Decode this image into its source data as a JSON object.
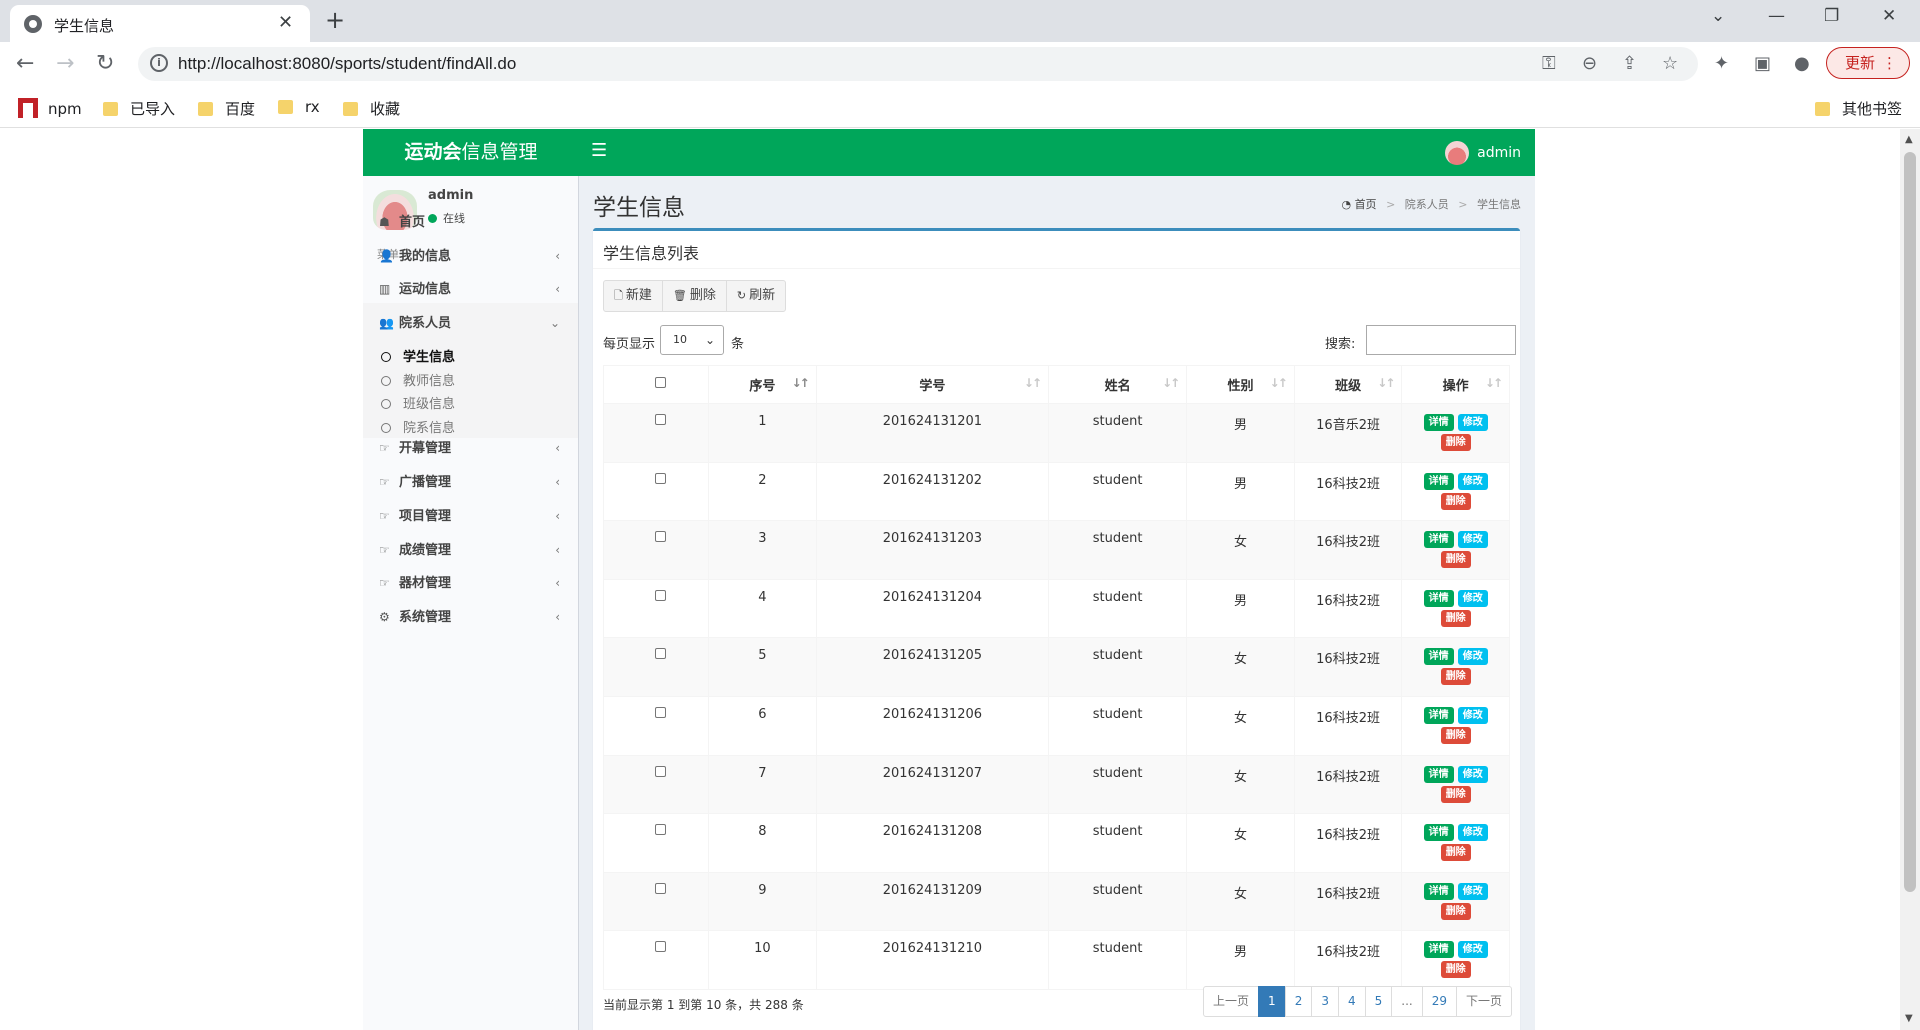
{
  "browser": {
    "tab_title": "学生信息",
    "url": "http://localhost:8080/sports/student/findAll.do",
    "update_label": "更新",
    "bookmarks": [
      {
        "label": "npm",
        "kind": "npm"
      },
      {
        "label": "已导入",
        "kind": "folder"
      },
      {
        "label": "百度",
        "kind": "folder"
      },
      {
        "label": "rx",
        "kind": "folder"
      },
      {
        "label": "收藏",
        "kind": "folder"
      }
    ],
    "other_bookmarks": "其他书签"
  },
  "app": {
    "brand_bold": "运动会",
    "brand_rest": "信息管理",
    "top_user": "admin",
    "accent": "#00a65a"
  },
  "sidebar": {
    "user_name": "admin",
    "user_status": "在线",
    "menu_header": "菜单",
    "items": [
      {
        "label": "首页",
        "icon": "home-icon",
        "glyph": "☗",
        "chevron": ""
      },
      {
        "label": "我的信息",
        "icon": "user-icon",
        "glyph": "👤",
        "chevron": "‹"
      },
      {
        "label": "运动信息",
        "icon": "bar-chart-icon",
        "glyph": "▥",
        "chevron": "‹"
      },
      {
        "label": "院系人员",
        "icon": "users-icon",
        "glyph": "👥",
        "chevron": "⌄"
      },
      {
        "label": "开幕管理",
        "icon": "hand-point-icon",
        "glyph": "☞",
        "chevron": "‹"
      },
      {
        "label": "广播管理",
        "icon": "hand-point-icon",
        "glyph": "☞",
        "chevron": "‹"
      },
      {
        "label": "项目管理",
        "icon": "hand-point-icon",
        "glyph": "☞",
        "chevron": "‹"
      },
      {
        "label": "成绩管理",
        "icon": "hand-point-icon",
        "glyph": "☞",
        "chevron": "‹"
      },
      {
        "label": "器材管理",
        "icon": "hand-point-icon",
        "glyph": "☞",
        "chevron": "‹"
      },
      {
        "label": "系统管理",
        "icon": "gear-icon",
        "glyph": "⚙",
        "chevron": "‹"
      }
    ],
    "submenu": [
      "学生信息",
      "教师信息",
      "班级信息",
      "院系信息"
    ]
  },
  "page": {
    "title": "学生信息",
    "breadcrumb": [
      "首页",
      "院系人员",
      "学生信息"
    ],
    "box_title": "学生信息列表",
    "buttons": {
      "new": "新建",
      "delete": "删除",
      "refresh": "刷新"
    },
    "length_label": "每页显示",
    "length_value": "10",
    "length_unit": "条",
    "search_label": "搜索:",
    "search_value": ""
  },
  "table": {
    "headers": [
      "序号",
      "学号",
      "姓名",
      "性别",
      "班级",
      "操作"
    ],
    "actions": {
      "detail": "详情",
      "edit": "修改",
      "delete": "删除"
    },
    "rows": [
      {
        "no": "1",
        "sid": "201624131201",
        "name": "student",
        "gender": "男",
        "cls": "16音乐2班"
      },
      {
        "no": "2",
        "sid": "201624131202",
        "name": "student",
        "gender": "男",
        "cls": "16科技2班"
      },
      {
        "no": "3",
        "sid": "201624131203",
        "name": "student",
        "gender": "女",
        "cls": "16科技2班"
      },
      {
        "no": "4",
        "sid": "201624131204",
        "name": "student",
        "gender": "男",
        "cls": "16科技2班"
      },
      {
        "no": "5",
        "sid": "201624131205",
        "name": "student",
        "gender": "女",
        "cls": "16科技2班"
      },
      {
        "no": "6",
        "sid": "201624131206",
        "name": "student",
        "gender": "女",
        "cls": "16科技2班"
      },
      {
        "no": "7",
        "sid": "201624131207",
        "name": "student",
        "gender": "女",
        "cls": "16科技2班"
      },
      {
        "no": "8",
        "sid": "201624131208",
        "name": "student",
        "gender": "女",
        "cls": "16科技2班"
      },
      {
        "no": "9",
        "sid": "201624131209",
        "name": "student",
        "gender": "女",
        "cls": "16科技2班"
      },
      {
        "no": "10",
        "sid": "201624131210",
        "name": "student",
        "gender": "男",
        "cls": "16科技2班"
      }
    ]
  },
  "footer": {
    "info": "当前显示第 1 到第 10 条，共 288 条",
    "pages": [
      "上一页",
      "1",
      "2",
      "3",
      "4",
      "5",
      "...",
      "29",
      "下一页"
    ],
    "current_page": "1"
  }
}
